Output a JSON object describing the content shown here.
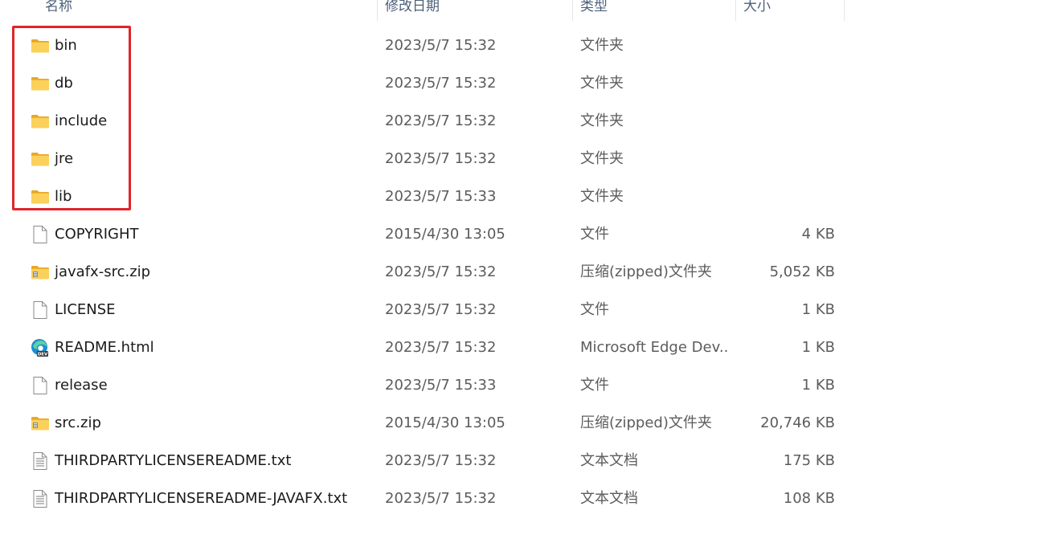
{
  "columns": {
    "name": "名称",
    "date": "修改日期",
    "type": "类型",
    "size": "大小"
  },
  "files": [
    {
      "name": "bin",
      "date": "2023/5/7 15:32",
      "type": "文件夹",
      "size": "",
      "icon": "folder-icon"
    },
    {
      "name": "db",
      "date": "2023/5/7 15:32",
      "type": "文件夹",
      "size": "",
      "icon": "folder-icon"
    },
    {
      "name": "include",
      "date": "2023/5/7 15:32",
      "type": "文件夹",
      "size": "",
      "icon": "folder-icon"
    },
    {
      "name": "jre",
      "date": "2023/5/7 15:32",
      "type": "文件夹",
      "size": "",
      "icon": "folder-icon"
    },
    {
      "name": "lib",
      "date": "2023/5/7 15:33",
      "type": "文件夹",
      "size": "",
      "icon": "folder-icon"
    },
    {
      "name": "COPYRIGHT",
      "date": "2015/4/30 13:05",
      "type": "文件",
      "size": "4 KB",
      "icon": "file-icon"
    },
    {
      "name": "javafx-src.zip",
      "date": "2023/5/7 15:32",
      "type": "压缩(zipped)文件夹",
      "size": "5,052 KB",
      "icon": "zip-folder-icon"
    },
    {
      "name": "LICENSE",
      "date": "2023/5/7 15:32",
      "type": "文件",
      "size": "1 KB",
      "icon": "file-icon"
    },
    {
      "name": "README.html",
      "date": "2023/5/7 15:32",
      "type": "Microsoft Edge Dev...",
      "size": "1 KB",
      "icon": "edge-dev-icon"
    },
    {
      "name": "release",
      "date": "2023/5/7 15:33",
      "type": "文件",
      "size": "1 KB",
      "icon": "file-icon"
    },
    {
      "name": "src.zip",
      "date": "2015/4/30 13:05",
      "type": "压缩(zipped)文件夹",
      "size": "20,746 KB",
      "icon": "zip-folder-icon"
    },
    {
      "name": "THIRDPARTYLICENSEREADME.txt",
      "date": "2023/5/7 15:32",
      "type": "文本文档",
      "size": "175 KB",
      "icon": "text-file-icon"
    },
    {
      "name": "THIRDPARTYLICENSEREADME-JAVAFX.txt",
      "date": "2023/5/7 15:32",
      "type": "文本文档",
      "size": "108 KB",
      "icon": "text-file-icon"
    }
  ],
  "colors": {
    "highlight": "#e0252b",
    "folder": "#f8c84a"
  }
}
